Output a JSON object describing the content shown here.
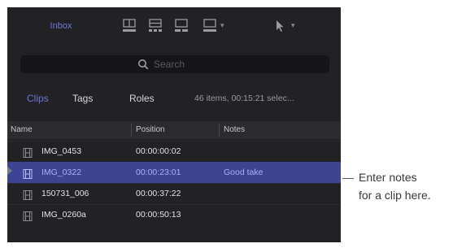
{
  "toolbar": {
    "inbox_button_label": "Inbox",
    "icons": [
      "clip-skimming-icon",
      "clip-layout-icon",
      "clip-filter-icon",
      "clip-view-icon",
      "tool-pointer-icon"
    ]
  },
  "search": {
    "placeholder": "Search",
    "value": ""
  },
  "tabs": [
    {
      "label": "Clips",
      "active": true
    },
    {
      "label": "Tags",
      "active": false
    },
    {
      "label": "Roles",
      "active": false
    }
  ],
  "status": "46 items, 00:15:21 selec...",
  "columns": [
    "Name",
    "Position",
    "Notes"
  ],
  "rows": [
    {
      "name": "IMG_0453",
      "position": "00:00:00:02",
      "notes": "",
      "selected": false
    },
    {
      "name": "IMG_0322",
      "position": "00:00:23:01",
      "notes": "Good take",
      "selected": true
    },
    {
      "name": "150731_006",
      "position": "00:00:37:22",
      "notes": "",
      "selected": false
    },
    {
      "name": "IMG_0260a",
      "position": "00:00:50:13",
      "notes": "",
      "selected": false
    }
  ],
  "callout": {
    "line1": "Enter notes",
    "line2": "for a clip here."
  },
  "colors": {
    "panel_bg": "#222225",
    "accent": "#6d75d4",
    "selection": "#3c4593"
  }
}
